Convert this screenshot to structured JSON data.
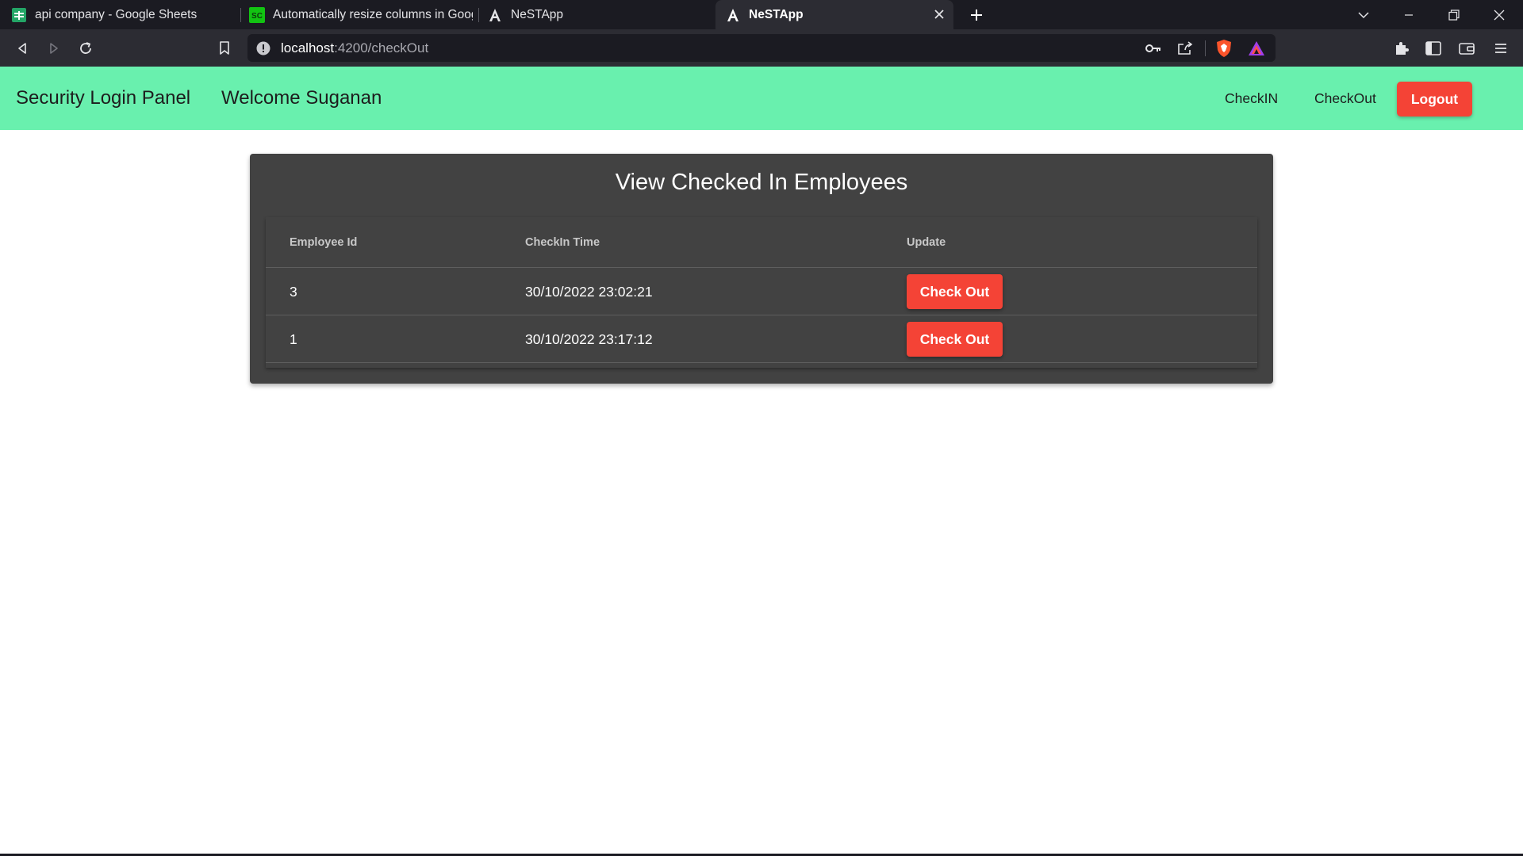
{
  "browser": {
    "tabs": [
      {
        "title": "api company - Google Sheets",
        "icon": "google-sheets-icon",
        "active": false
      },
      {
        "title": "Automatically resize columns in Googl",
        "icon": "sc-site-icon",
        "icon_text": "SC",
        "active": false
      },
      {
        "title": "NeSTApp",
        "icon": "angular-icon",
        "active": false
      },
      {
        "title": "NeSTApp",
        "icon": "angular-icon",
        "active": true
      }
    ],
    "url": {
      "host": "localhost",
      "path": ":4200/checkOut"
    },
    "colors": {
      "tabstrip": "#1b1b22",
      "toolbar": "#2c2c33",
      "omnibox": "#1b1b22"
    }
  },
  "navbar": {
    "brand": "Security Login Panel",
    "welcome": "Welcome Suganan",
    "links": [
      "CheckIN",
      "CheckOut"
    ],
    "logout_label": "Logout",
    "colors": {
      "background": "#69f0ae",
      "logout": "#f44336"
    }
  },
  "main": {
    "title": "View Checked In Employees",
    "table": {
      "headers": [
        "Employee Id",
        "CheckIn Time",
        "Update"
      ],
      "rows": [
        {
          "employee_id": "3",
          "checkin_time": "30/10/2022 23:02:21",
          "action": "Check Out"
        },
        {
          "employee_id": "1",
          "checkin_time": "30/10/2022 23:17:12",
          "action": "Check Out"
        }
      ]
    },
    "colors": {
      "card": "#424242",
      "button": "#f44336"
    }
  }
}
